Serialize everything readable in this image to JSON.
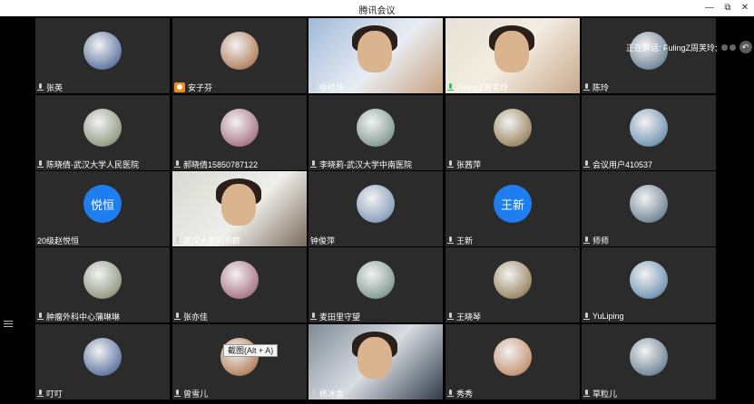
{
  "window": {
    "title": "腾讯会议",
    "minimize_glyph": "—",
    "maximize_glyph": "⧉",
    "close_glyph": "✕"
  },
  "speaking": {
    "label": "正在讲话: FulingZ周芙玲;",
    "icon": "back-arrow-icon"
  },
  "tooltip": {
    "text": "截图(Alt + A)"
  },
  "colors": {
    "active_outline": "#2fbf71",
    "host_badge": "#f08a1c",
    "initials_avatar": "#1e7ef0"
  },
  "participants": [
    {
      "name": "张英",
      "mic": "muted",
      "avatar": "photo"
    },
    {
      "name": "安子芬",
      "mic": "host",
      "avatar": "photo"
    },
    {
      "name": "徐桂华",
      "mic": "muted",
      "avatar": "video"
    },
    {
      "name": "FulingZ周芙玲",
      "mic": "speaking",
      "avatar": "video"
    },
    {
      "name": "陈玲",
      "mic": "muted",
      "avatar": "photo"
    },
    {
      "name": "陈晓倩-武汉大学人民医院",
      "mic": "muted",
      "avatar": "photo"
    },
    {
      "name": "郝晓倩15850787122",
      "mic": "muted",
      "avatar": "photo"
    },
    {
      "name": "李晓莉-武汉大学中南医院",
      "mic": "muted",
      "avatar": "photo"
    },
    {
      "name": "张茜萍",
      "mic": "muted",
      "avatar": "photo"
    },
    {
      "name": "会议用户410537",
      "mic": "muted",
      "avatar": "photo"
    },
    {
      "name": "20级赵悦恒",
      "mic": "none",
      "avatar": "initials",
      "initials": "悦恒"
    },
    {
      "name": "武汉大学刘燕群",
      "mic": "muted",
      "avatar": "video"
    },
    {
      "name": "钟俊萍",
      "mic": "none",
      "avatar": "photo"
    },
    {
      "name": "王新",
      "mic": "muted",
      "avatar": "initials",
      "initials": "王新"
    },
    {
      "name": "师师",
      "mic": "muted",
      "avatar": "photo"
    },
    {
      "name": "肿瘤外科中心蒲琳琳",
      "mic": "muted",
      "avatar": "photo"
    },
    {
      "name": "张亦佳",
      "mic": "muted",
      "avatar": "photo"
    },
    {
      "name": "麦田里守望",
      "mic": "muted",
      "avatar": "photo"
    },
    {
      "name": "王晓琴",
      "mic": "muted",
      "avatar": "photo"
    },
    {
      "name": "YuLiping",
      "mic": "muted",
      "avatar": "photo"
    },
    {
      "name": "叮叮",
      "mic": "muted",
      "avatar": "photo"
    },
    {
      "name": "曾雪儿",
      "mic": "muted",
      "avatar": "photo"
    },
    {
      "name": "杨冰香",
      "mic": "muted",
      "avatar": "video"
    },
    {
      "name": "秀秀",
      "mic": "muted",
      "avatar": "photo"
    },
    {
      "name": "草粒儿",
      "mic": "muted",
      "avatar": "photo"
    }
  ]
}
